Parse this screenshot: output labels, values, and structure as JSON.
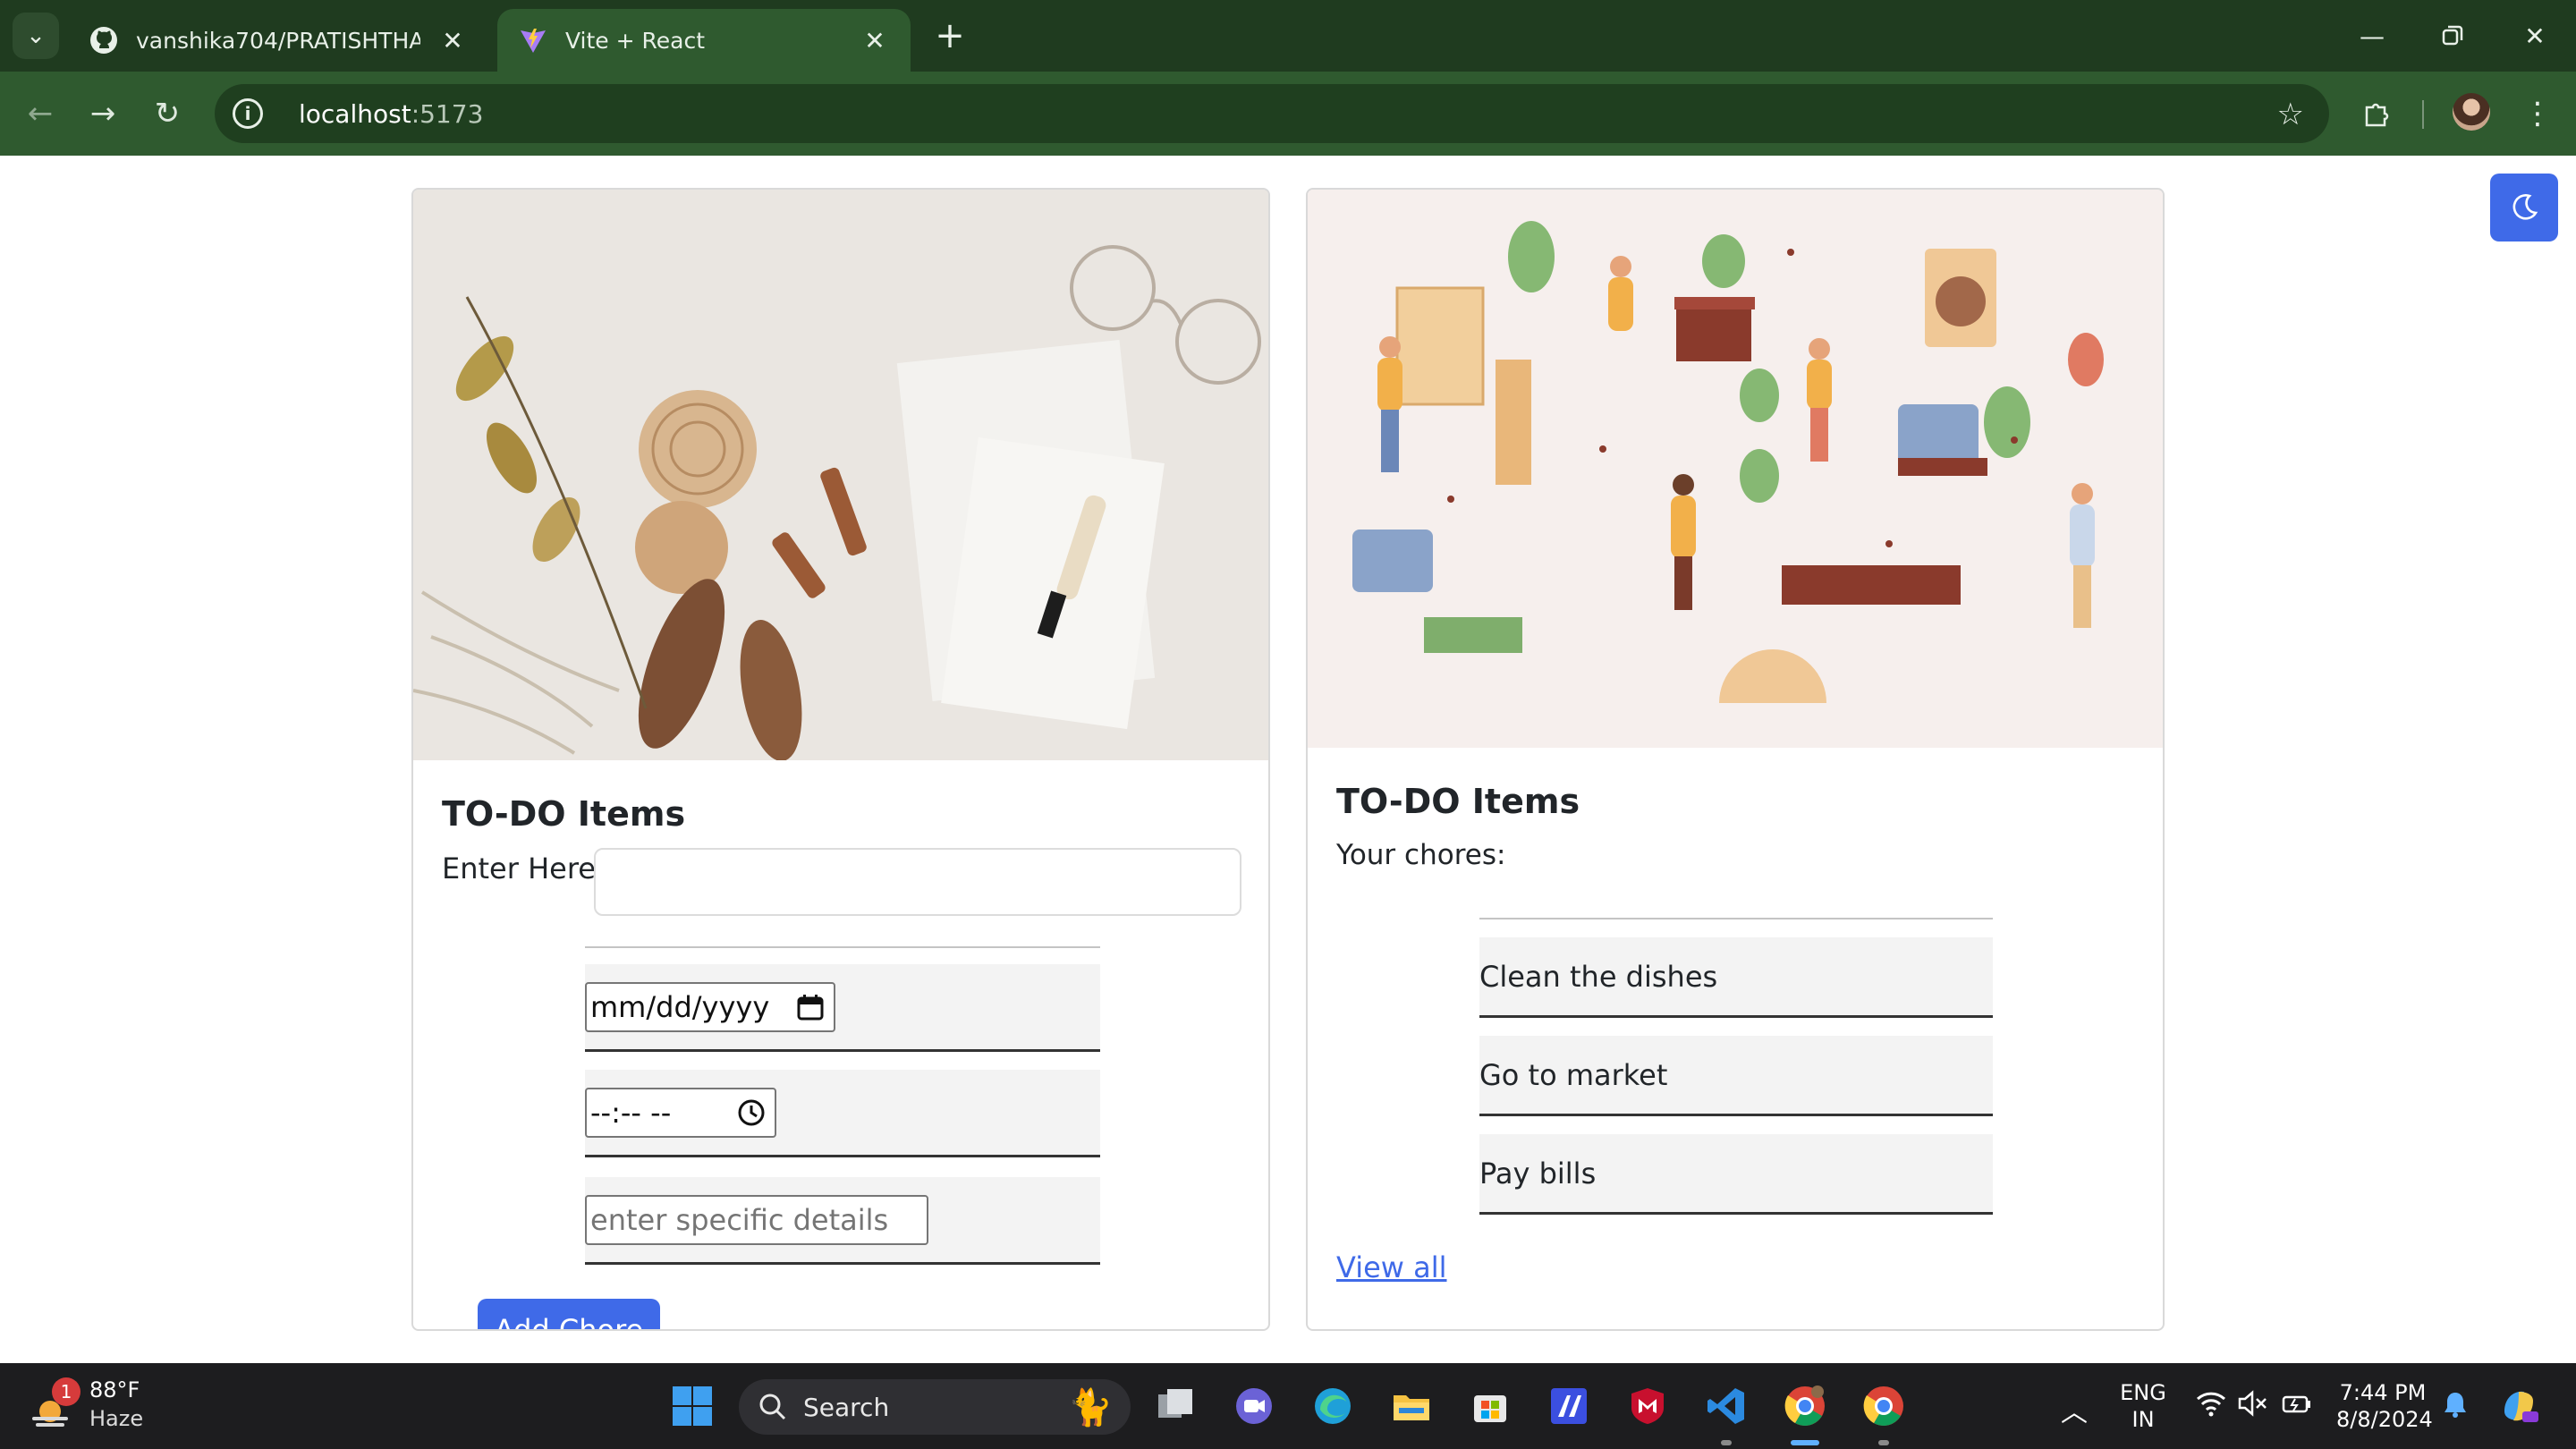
{
  "browser": {
    "tabs": [
      {
        "title": "vanshika704/PRATISHTHA",
        "favicon": "github-icon",
        "active": false
      },
      {
        "title": "Vite + React",
        "favicon": "vite-icon",
        "active": true
      }
    ],
    "url_host": "localhost",
    "url_port": ":5173"
  },
  "todo_form": {
    "title": "TO-DO Items",
    "enter_label": "Enter Here",
    "input_value": "",
    "date_value": "mm/dd/yyyy",
    "time_value": "--:-- --",
    "details_placeholder": "enter specific details",
    "add_button": "Add Chore"
  },
  "chores_panel": {
    "title": "TO-DO Items",
    "subtitle": "Your chores:",
    "items": [
      "Clean the dishes",
      "Go to market",
      "Pay bills"
    ],
    "view_all": "View all"
  },
  "taskbar": {
    "weather_temp": "88°F",
    "weather_cond": "Haze",
    "weather_badge": "1",
    "search_label": "Search",
    "lang_top": "ENG",
    "lang_bottom": "IN",
    "time": "7:44 PM",
    "date": "8/8/2024"
  },
  "colors": {
    "chrome_dark": "#1f3b1f",
    "chrome_toolbar": "#2f5a2f",
    "accent_blue": "#3f6ae8",
    "taskbar": "#1d1d1f"
  }
}
